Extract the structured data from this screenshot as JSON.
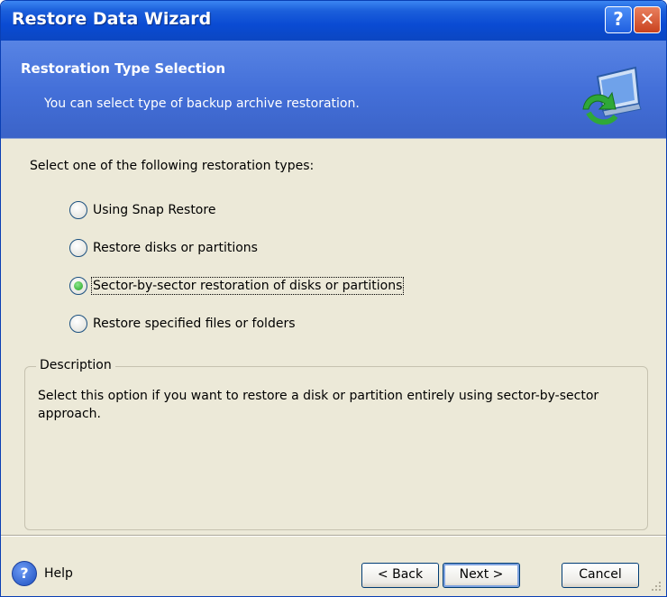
{
  "window": {
    "title": "Restore Data Wizard",
    "help_glyph": "?",
    "close_glyph": "✕"
  },
  "header": {
    "title": "Restoration Type Selection",
    "subtitle": "You can select type of backup archive restoration.",
    "icon": "restore-computer-icon"
  },
  "content": {
    "prompt": "Select one of the following restoration types:",
    "options": [
      {
        "label": "Using Snap Restore",
        "selected": false
      },
      {
        "label": "Restore disks or partitions",
        "selected": false
      },
      {
        "label": "Sector-by-sector restoration of disks or partitions",
        "selected": true
      },
      {
        "label": "Restore specified files or folders",
        "selected": false
      }
    ],
    "description": {
      "legend": "Description",
      "text": "Select this option if you want to restore a disk or partition entirely using sector-by-sector approach."
    }
  },
  "footer": {
    "help_label": "Help",
    "help_icon_glyph": "?",
    "back_label": "< Back",
    "next_label": "Next >",
    "cancel_label": "Cancel"
  }
}
